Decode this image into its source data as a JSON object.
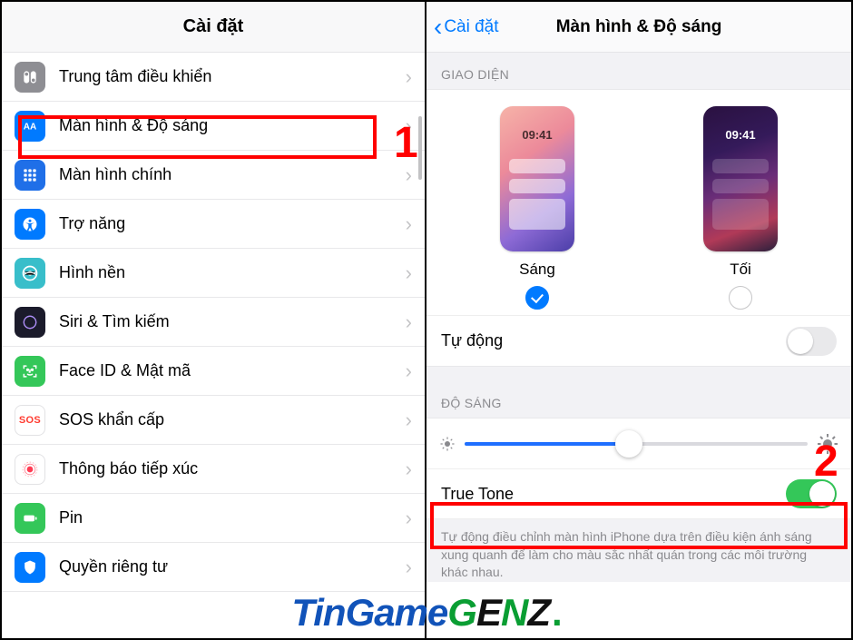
{
  "left": {
    "title": "Cài đặt",
    "items": [
      {
        "label": "Trung tâm điều khiển"
      },
      {
        "label": "Màn hình & Độ sáng"
      },
      {
        "label": "Màn hình chính"
      },
      {
        "label": "Trợ năng"
      },
      {
        "label": "Hình nền"
      },
      {
        "label": "Siri & Tìm kiếm"
      },
      {
        "label": "Face ID & Mật mã"
      },
      {
        "label": "SOS khẩn cấp"
      },
      {
        "label": "Thông báo tiếp xúc"
      },
      {
        "label": "Pin"
      },
      {
        "label": "Quyền riêng tư"
      }
    ],
    "sos_icon_text": "SOS",
    "annotation": "1"
  },
  "right": {
    "back_label": "Cài đặt",
    "title": "Màn hình & Độ sáng",
    "section_appearance": "GIAO DIỆN",
    "preview_time": "09:41",
    "option_light": "Sáng",
    "option_dark": "Tối",
    "automatic_label": "Tự động",
    "automatic_on": false,
    "section_brightness": "ĐỘ SÁNG",
    "brightness_percent": 48,
    "truetone_label": "True Tone",
    "truetone_on": true,
    "truetone_footer": "Tự động điều chỉnh màn hình iPhone dựa trên điều kiện ánh sáng xung quanh để làm cho màu sắc nhất quán trong các môi trường khác nhau.",
    "annotation": "2"
  },
  "watermark": {
    "t1": "TinGame",
    "t2": "G",
    "t3": "E",
    "t4": "N",
    "t5": "Z",
    "dot": "."
  }
}
